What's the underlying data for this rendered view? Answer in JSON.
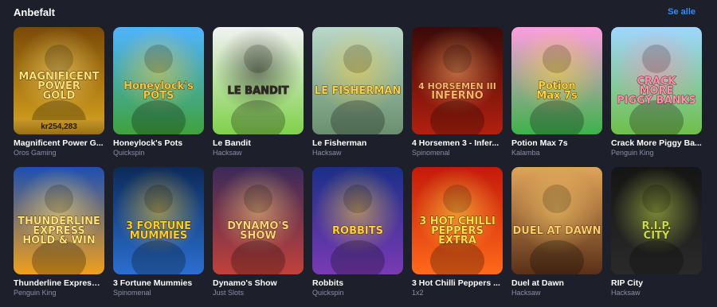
{
  "section": {
    "title": "Anbefalt",
    "see_all_label": "Se alle"
  },
  "games": [
    {
      "title": "Magnificent Power G...",
      "provider": "Oros Gaming",
      "art_text": "MAGNIFICENT POWER GOLD",
      "art_text_lines": [
        "MAGNIFICENT",
        "POWER",
        "GOLD"
      ],
      "jackpot": "kr254,283",
      "colors": {
        "bg1": "#7a4a06",
        "bg2": "#d9a520",
        "accent": "#ffe27a"
      }
    },
    {
      "title": "Honeylock's Pots",
      "provider": "Quickspin",
      "art_text": "Honeylock's POTS",
      "art_text_lines": [
        "Honeylock's",
        "POTS"
      ],
      "colors": {
        "bg1": "#4fb3ff",
        "bg2": "#3fa23a",
        "accent": "#f3c844"
      }
    },
    {
      "title": "Le Bandit",
      "provider": "Hacksaw",
      "art_text": "LE BANDIT",
      "art_text_lines": [
        "LE BANDIT"
      ],
      "colors": {
        "bg1": "#f2f2f2",
        "bg2": "#7fd14a",
        "accent": "#2a2a2a"
      }
    },
    {
      "title": "Le Fisherman",
      "provider": "Hacksaw",
      "art_text": "LE FISHERMAN",
      "art_text_lines": [
        "LE FISHERMAN"
      ],
      "colors": {
        "bg1": "#b9d7c8",
        "bg2": "#6a8f6e",
        "accent": "#f5d24a"
      }
    },
    {
      "title": "4 Horsemen 3 - Infer...",
      "provider": "Spinomenal",
      "art_text": "4 HORSEMEN III INFERNO",
      "art_text_lines": [
        "4 HORSEMEN III",
        "INFERNO"
      ],
      "colors": {
        "bg1": "#3a0a08",
        "bg2": "#b3200f",
        "accent": "#ffb36a"
      }
    },
    {
      "title": "Potion Max 7s",
      "provider": "Kalamba",
      "art_text": "Potion Max 7s",
      "art_text_lines": [
        "Potion",
        "Max 7s"
      ],
      "colors": {
        "bg1": "#ff9de0",
        "bg2": "#3bb34a",
        "accent": "#ffd23a"
      }
    },
    {
      "title": "Crack More Piggy Ba...",
      "provider": "Penguin King",
      "art_text": "CRACK MORE PIGGY BANKS",
      "art_text_lines": [
        "CRACK",
        "MORE",
        "PIGGY BANKS"
      ],
      "colors": {
        "bg1": "#9fd7ff",
        "bg2": "#6fbf4a",
        "accent": "#ff8fb0"
      }
    },
    {
      "title": "Thunderline Express:...",
      "provider": "Penguin King",
      "art_text": "THUNDERLINE EXPRESS HOLD & WIN",
      "art_text_lines": [
        "THUNDERLINE",
        "EXPRESS",
        "HOLD & WIN"
      ],
      "colors": {
        "bg1": "#1d4fb3",
        "bg2": "#f0a01a",
        "accent": "#ffe27a"
      }
    },
    {
      "title": "3 Fortune Mummies",
      "provider": "Spinomenal",
      "art_text": "3 FORTUNE MUMMIES",
      "art_text_lines": [
        "3 FORTUNE",
        "MUMMIES"
      ],
      "colors": {
        "bg1": "#0c2a5a",
        "bg2": "#2b6fd1",
        "accent": "#ffcc2a"
      }
    },
    {
      "title": "Dynamo's Show",
      "provider": "Just Slots",
      "art_text": "Dynamo's Show",
      "art_text_lines": [
        "DYNAMO'S",
        "SHOW"
      ],
      "colors": {
        "bg1": "#3a2a5a",
        "bg2": "#c2413a",
        "accent": "#ffd37a"
      }
    },
    {
      "title": "Robbits",
      "provider": "Quickspin",
      "art_text": "ROBBITS",
      "art_text_lines": [
        "ROBBITS"
      ],
      "colors": {
        "bg1": "#1b2f8a",
        "bg2": "#7a3ab3",
        "accent": "#ffd23a"
      }
    },
    {
      "title": "3 Hot Chilli Peppers ...",
      "provider": "1x2",
      "art_text": "3 HOT CHILLI PEPPERS EXTRA",
      "art_text_lines": [
        "3 HOT CHILLI",
        "PEPPERS",
        "EXTRA"
      ],
      "colors": {
        "bg1": "#c41a0a",
        "bg2": "#ff6a1a",
        "accent": "#ffe04a"
      }
    },
    {
      "title": "Duel at Dawn",
      "provider": "Hacksaw",
      "art_text": "DUEL AT DAWN",
      "art_text_lines": [
        "DUEL AT DAWN"
      ],
      "colors": {
        "bg1": "#e0a45a",
        "bg2": "#5a3018",
        "accent": "#ffcf6a"
      }
    },
    {
      "title": "RIP City",
      "provider": "Hacksaw",
      "art_text": "R.I.P. CITY",
      "art_text_lines": [
        "R.I.P.",
        "CITY"
      ],
      "colors": {
        "bg1": "#151515",
        "bg2": "#2a2a2a",
        "accent": "#c6e04a"
      }
    }
  ]
}
